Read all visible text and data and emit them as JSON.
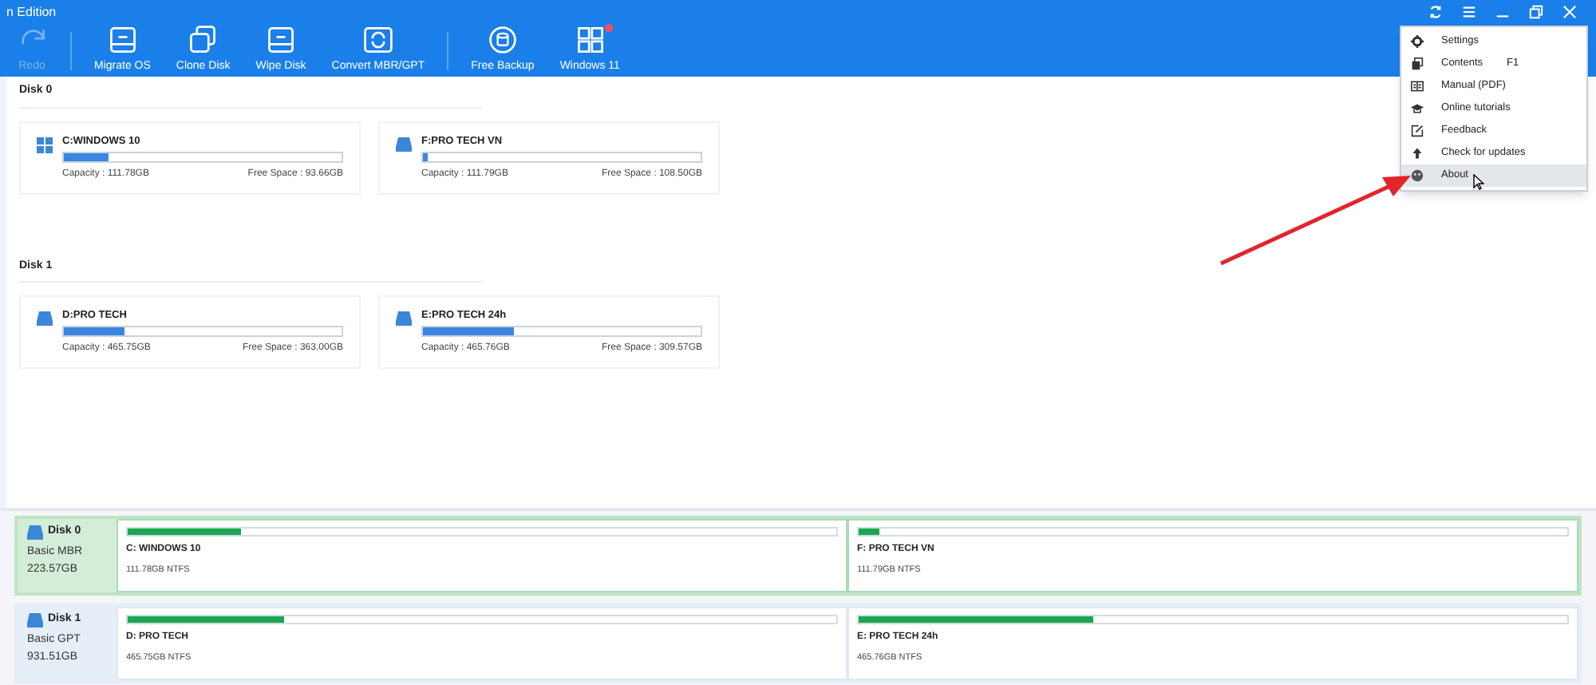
{
  "window": {
    "title": "n Edition"
  },
  "toolbar": [
    {
      "label": "Redo",
      "disabled": true,
      "badge": false
    },
    {
      "label": "Migrate OS",
      "disabled": false,
      "badge": false
    },
    {
      "label": "Clone Disk",
      "disabled": false,
      "badge": false
    },
    {
      "label": "Wipe Disk",
      "disabled": false,
      "badge": false
    },
    {
      "label": "Convert MBR/GPT",
      "disabled": false,
      "badge": false
    },
    {
      "label": "Free Backup",
      "disabled": false,
      "badge": false
    },
    {
      "label": "Windows 11",
      "disabled": false,
      "badge": true
    }
  ],
  "menu": [
    {
      "label": "Settings",
      "selected": false
    },
    {
      "label": "Contents",
      "shortcut": "F1",
      "selected": false
    },
    {
      "label": "Manual (PDF)",
      "selected": false
    },
    {
      "label": "Online tutorials",
      "selected": false
    },
    {
      "label": "Feedback",
      "selected": false
    },
    {
      "label": "Check for updates",
      "selected": false
    },
    {
      "label": "About",
      "selected": true
    }
  ],
  "disks": [
    {
      "label": "Disk 0",
      "partitions": [
        {
          "name": "C:WINDOWS 10",
          "kind": "system",
          "level": 0.16,
          "capacity": "Capacity : 111.78GB",
          "free": "Free Space : 93.66GB"
        },
        {
          "name": "F:PRO TECH VN",
          "kind": "data",
          "level": 0.02,
          "capacity": "Capacity : 111.79GB",
          "free": "Free Space : 108.50GB"
        }
      ]
    },
    {
      "label": "Disk 1",
      "partitions": [
        {
          "name": "D:PRO TECH",
          "kind": "data",
          "level": 0.22,
          "capacity": "Capacity : 465.75GB",
          "free": "Free Space : 363.00GB"
        },
        {
          "name": "E:PRO TECH 24h",
          "kind": "data",
          "level": 0.33,
          "capacity": "Capacity : 465.76GB",
          "free": "Free Space : 309.57GB"
        }
      ]
    }
  ],
  "disk_map": [
    {
      "name": "Disk 0",
      "type": "Basic MBR",
      "size": "223.57GB",
      "selected": true,
      "partitions": [
        {
          "name": "C: WINDOWS 10",
          "info": "111.78GB NTFS",
          "level": 0.16
        },
        {
          "name": "F: PRO TECH VN",
          "info": "111.79GB NTFS",
          "level": 0.03
        }
      ]
    },
    {
      "name": "Disk 1",
      "type": "Basic GPT",
      "size": "931.51GB",
      "selected": false,
      "partitions": [
        {
          "name": "D: PRO TECH",
          "info": "465.75GB NTFS",
          "level": 0.22
        },
        {
          "name": "E: PRO TECH 24h",
          "info": "465.76GB NTFS",
          "level": 0.33
        }
      ]
    }
  ]
}
